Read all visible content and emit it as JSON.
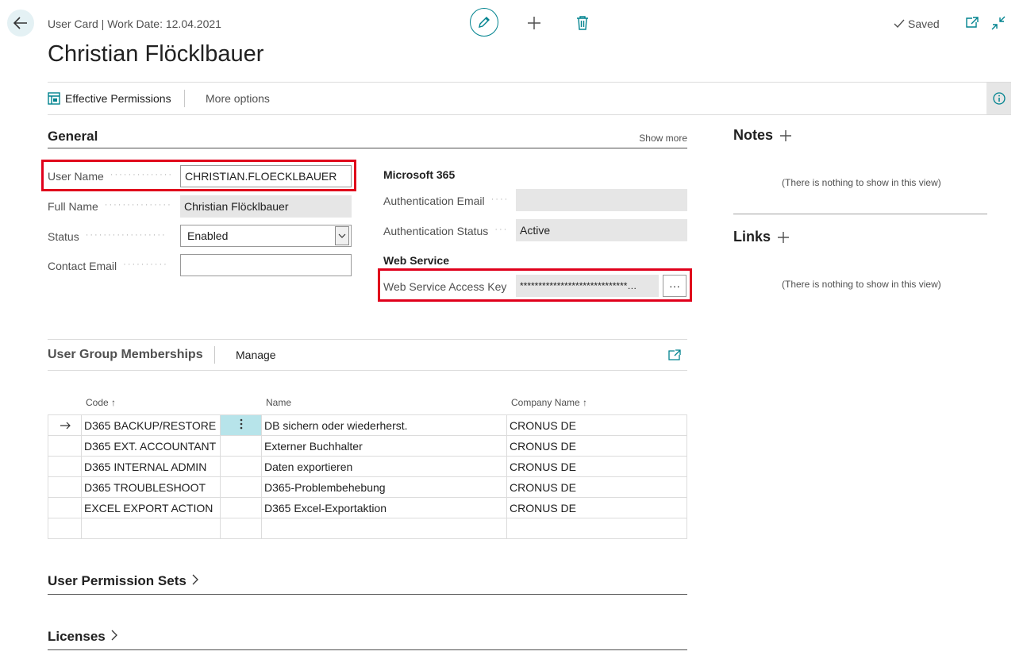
{
  "header": {
    "breadcrumb": "User Card | Work Date: 12.04.2021",
    "title": "Christian Flöcklbauer",
    "saved_label": "Saved"
  },
  "actions": {
    "effective_permissions": "Effective Permissions",
    "more_options": "More options"
  },
  "general": {
    "title": "General",
    "show_more": "Show more",
    "user_name_label": "User Name",
    "user_name_value": "CHRISTIAN.FLOECKLBAUER",
    "full_name_label": "Full Name",
    "full_name_value": "Christian Flöcklbauer",
    "status_label": "Status",
    "status_value": "Enabled",
    "contact_email_label": "Contact Email",
    "contact_email_value": "",
    "m365_title": "Microsoft 365",
    "auth_email_label": "Authentication Email",
    "auth_email_value": "",
    "auth_status_label": "Authentication Status",
    "auth_status_value": "Active",
    "web_service_title": "Web Service",
    "ws_key_label": "Web Service Access Key",
    "ws_key_value": "*****************************…",
    "ws_key_button": "···"
  },
  "notes": {
    "title": "Notes",
    "empty": "(There is nothing to show in this view)"
  },
  "links": {
    "title": "Links",
    "empty": "(There is nothing to show in this view)"
  },
  "memberships": {
    "title": "User Group Memberships",
    "manage": "Manage",
    "columns": {
      "code": "Code ↑",
      "name": "Name",
      "company": "Company Name ↑"
    },
    "rows": [
      {
        "code": "D365 BACKUP/RESTORE",
        "name": "DB sichern oder wiederherst.",
        "company": "CRONUS DE"
      },
      {
        "code": "D365 EXT. ACCOUNTANT",
        "name": "Externer Buchhalter",
        "company": "CRONUS DE"
      },
      {
        "code": "D365 INTERNAL ADMIN",
        "name": "Daten exportieren",
        "company": "CRONUS DE"
      },
      {
        "code": "D365 TROUBLESHOOT",
        "name": "D365-Problembehebung",
        "company": "CRONUS DE"
      },
      {
        "code": "EXCEL EXPORT ACTION",
        "name": "D365 Excel-Exportaktion",
        "company": "CRONUS DE"
      }
    ]
  },
  "fasttabs": {
    "permission_sets": "User Permission Sets",
    "licenses": "Licenses"
  },
  "colors": {
    "accent": "#00838f",
    "highlight": "#e0001b",
    "selected_cell": "#b7e4ea"
  }
}
